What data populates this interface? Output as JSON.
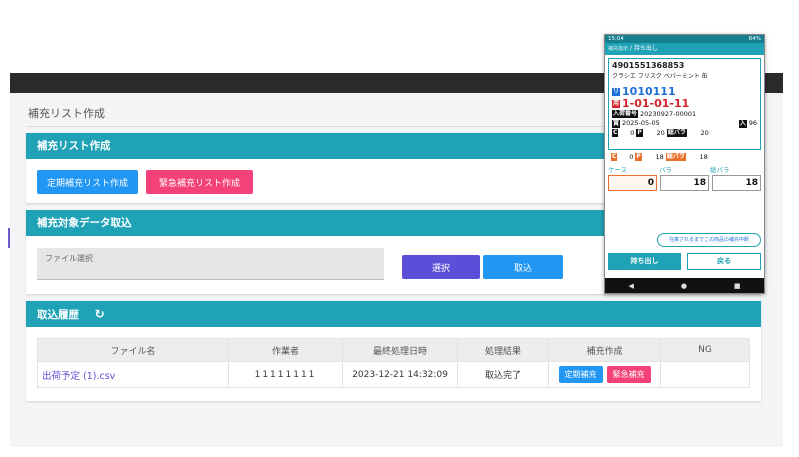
{
  "page": {
    "title": "補充リスト作成"
  },
  "card_create": {
    "header": "補充リスト作成",
    "btn_regular": "定期補充リスト作成",
    "btn_urgent": "緊急補充リスト作成"
  },
  "card_import": {
    "header": "補充対象データ取込",
    "file_label": "ファイル選択",
    "btn_select": "選択",
    "btn_import": "取込"
  },
  "card_history": {
    "header": "取込履歴",
    "refresh_icon": "refresh-icon",
    "columns": [
      "ファイル名",
      "作業者",
      "最終処理日時",
      "処理結果",
      "補充作成",
      "NG"
    ],
    "rows": [
      {
        "file": "出荷予定 (1).csv",
        "worker": "11111111",
        "datetime": "2023-12-21 14:32:09",
        "result": "取込完了",
        "btn_regular": "定期補充",
        "btn_urgent": "緊急補充",
        "ng": ""
      }
    ]
  },
  "phone": {
    "status_time": "15:04",
    "status_right": "64%",
    "breadcrumb_parent": "補充指示",
    "breadcrumb_current": "持ち出し",
    "jan": "4901551368853",
    "product": "クラシエ フリスク ペパーミント 缶",
    "tag_ri": "リ",
    "ri_code": "1010111",
    "tag_ji": "用",
    "location": "1-01-01-11",
    "tag_lot": "入荷番号",
    "lot": "20230927-00001",
    "tag_exp": "賞",
    "expiry": "2025-05-05",
    "tag_in": "入",
    "in_qty": "96",
    "row1": {
      "c_tag": "C",
      "c_val": "0",
      "p_tag": "P",
      "p_val": "20",
      "b_tag": "総バラ",
      "b_val": "20"
    },
    "row2": {
      "c_tag": "C",
      "c_val": "0",
      "p_tag": "P",
      "p_val": "18",
      "b_tag": "総バラ",
      "b_val": "18"
    },
    "label_case": "ケース",
    "label_bara": "バラ",
    "label_total": "総バラ",
    "input_case": "0",
    "input_bara": "18",
    "input_total": "18",
    "oval_btn": "在庫されるまでこの商品の補充中断",
    "btn_take": "持ち出し",
    "btn_back": "戻る"
  },
  "colors": {
    "teal": "#1fa2b5",
    "blue": "#2196f3",
    "pink": "#f5417a",
    "purple": "#5b4fd9"
  }
}
